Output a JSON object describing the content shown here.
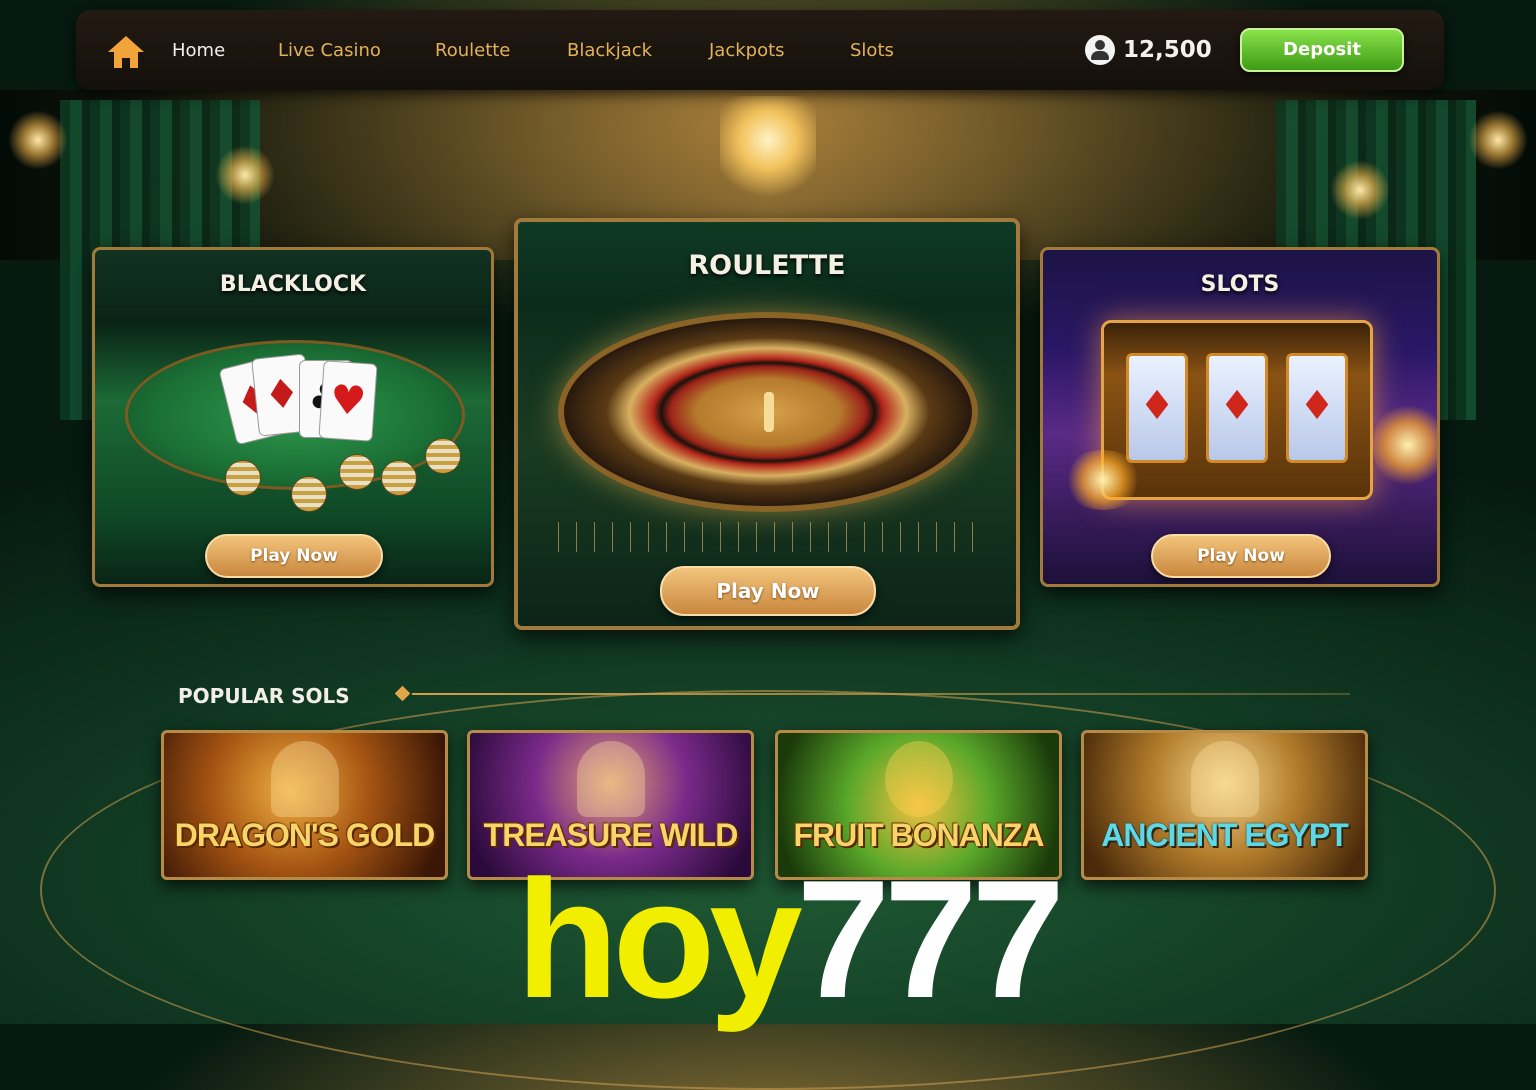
{
  "nav": {
    "items": [
      {
        "label": "Home",
        "active": true
      },
      {
        "label": "Live Casino",
        "active": false
      },
      {
        "label": "Roulette",
        "active": false
      },
      {
        "label": "Blackjack",
        "active": false
      },
      {
        "label": "Jackpots",
        "active": false
      },
      {
        "label": "Slots",
        "active": false
      }
    ],
    "home_icon": "home-icon",
    "balance": "12,500",
    "balance_icon": "user-icon",
    "deposit_label": "Deposit"
  },
  "featured": {
    "blackjack": {
      "title": "BLACKLOCK",
      "button": "Play Now"
    },
    "roulette": {
      "title": "ROULETTE",
      "button": "Play Now"
    },
    "slots": {
      "title": "SLOTS",
      "button": "Play Now"
    }
  },
  "popular": {
    "title": "POPULAR SOLS",
    "games": [
      {
        "name": "DRAGON'S GOLD"
      },
      {
        "name": "TREASURE WILD"
      },
      {
        "name": "FRUIT BONANZA"
      },
      {
        "name": "ANCIENT EGYPT"
      }
    ]
  },
  "watermark": {
    "part1": "hoy",
    "part2": "777"
  },
  "colors": {
    "accent_gold": "#e2b25a",
    "deposit_green": "#5cbf22",
    "felt_green": "#1c6a36"
  }
}
